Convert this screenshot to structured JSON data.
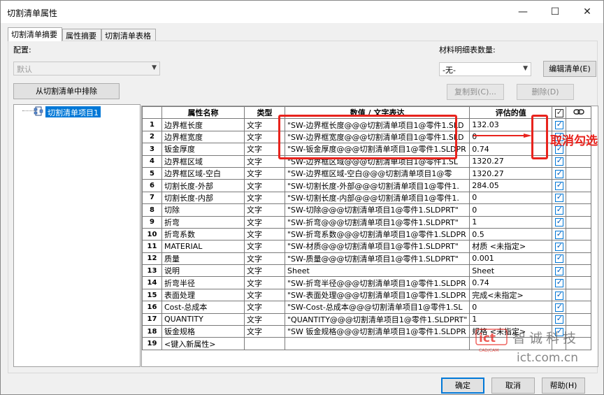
{
  "window": {
    "title": "切割清单属性",
    "minimize": "—",
    "maximize": "☐",
    "close": "✕"
  },
  "tabs": [
    "切割清单摘要",
    "属性摘要",
    "切割清单表格"
  ],
  "config": {
    "label": "配置:",
    "value": "默认"
  },
  "bom": {
    "label": "材料明细表数量:",
    "value": "-无-",
    "edit_button": "编辑清单(E)"
  },
  "buttons": {
    "exclude": "从切割清单中排除",
    "copy_to": "复制到(C)...",
    "delete": "删除(D)",
    "ok": "确定",
    "cancel": "取消",
    "help": "帮助(H)"
  },
  "tree": {
    "item": "切割清单项目1"
  },
  "table": {
    "headers": {
      "name": "属性名称",
      "type": "类型",
      "value": "数值 / 文字表达",
      "evaluated": "评估的值"
    },
    "rows": [
      {
        "n": "1",
        "name": "边界框长度",
        "type": "文字",
        "expr": "\"SW-边界框长度@@@切割清单项目1@零件1.SLD",
        "val": "132.03",
        "checked": true
      },
      {
        "n": "2",
        "name": "边界框宽度",
        "type": "文字",
        "expr": "\"SW-边界框宽度@@@切割清单项目1@零件1.SLD",
        "val": "0",
        "checked": true
      },
      {
        "n": "3",
        "name": "钣金厚度",
        "type": "文字",
        "expr": "\"SW-钣金厚度@@@切割清单项目1@零件1.SLDPR",
        "val": "0.74",
        "checked": true
      },
      {
        "n": "4",
        "name": "边界框区域",
        "type": "文字",
        "expr": "\"SW-边界框区域@@@切割清单项目1@零件1.SL",
        "val": "1320.27",
        "checked": true
      },
      {
        "n": "5",
        "name": "边界框区域-空白",
        "type": "文字",
        "expr": "\"SW-边界框区域-空白@@@切割清单项目1@零",
        "val": "1320.27",
        "checked": true
      },
      {
        "n": "6",
        "name": "切割长度-外部",
        "type": "文字",
        "expr": "\"SW-切割长度-外部@@@切割清单项目1@零件1.",
        "val": "284.05",
        "checked": true
      },
      {
        "n": "7",
        "name": "切割长度-内部",
        "type": "文字",
        "expr": "\"SW-切割长度-内部@@@切割清单项目1@零件1.",
        "val": "0",
        "checked": true
      },
      {
        "n": "8",
        "name": "切除",
        "type": "文字",
        "expr": "\"SW-切除@@@切割清单项目1@零件1.SLDPRT\"",
        "val": "0",
        "checked": true
      },
      {
        "n": "9",
        "name": "折弯",
        "type": "文字",
        "expr": "\"SW-折弯@@@切割清单项目1@零件1.SLDPRT\"",
        "val": "1",
        "checked": true
      },
      {
        "n": "10",
        "name": "折弯系数",
        "type": "文字",
        "expr": "\"SW-折弯系数@@@切割清单项目1@零件1.SLDPR",
        "val": "0.5",
        "checked": true
      },
      {
        "n": "11",
        "name": "MATERIAL",
        "type": "文字",
        "expr": "\"SW-材质@@@切割清单项目1@零件1.SLDPRT\"",
        "val": "材质 <未指定>",
        "checked": true
      },
      {
        "n": "12",
        "name": "质量",
        "type": "文字",
        "expr": "\"SW-质量@@@切割清单项目1@零件1.SLDPRT\"",
        "val": "0.001",
        "checked": true
      },
      {
        "n": "13",
        "name": "说明",
        "type": "文字",
        "expr": "Sheet",
        "val": "Sheet",
        "checked": true
      },
      {
        "n": "14",
        "name": "折弯半径",
        "type": "文字",
        "expr": "\"SW-折弯半径@@@切割清单项目1@零件1.SLDPR",
        "val": "0.74",
        "checked": true
      },
      {
        "n": "15",
        "name": "表面处理",
        "type": "文字",
        "expr": "\"SW-表面处理@@@切割清单项目1@零件1.SLDPR",
        "val": "完成<未指定>",
        "checked": true
      },
      {
        "n": "16",
        "name": "Cost-总成本",
        "type": "文字",
        "expr": "\"SW-Cost-总成本@@@切割清单项目1@零件1.SL",
        "val": "0",
        "checked": true
      },
      {
        "n": "17",
        "name": "QUANTITY",
        "type": "文字",
        "expr": "\"QUANTITY@@@切割清单项目1@零件1.SLDPRT\"",
        "val": "1",
        "checked": true
      },
      {
        "n": "18",
        "name": "钣金规格",
        "type": "文字",
        "expr": "\"SW 钣金规格@@@切割清单项目1@零件1.SLDPR",
        "val": "规格 <未指定>",
        "checked": true
      },
      {
        "n": "19",
        "name": "<键入新属性>",
        "type": "",
        "expr": "",
        "val": "",
        "checked": null
      }
    ]
  },
  "annotation": {
    "text": "取消勾选"
  },
  "watermark": {
    "brand": "智诚科技",
    "badge": "CAD/CAM",
    "url": "ict.com.cn"
  },
  "colors": {
    "accent": "#0078d7",
    "annotation": "#e8231d"
  }
}
